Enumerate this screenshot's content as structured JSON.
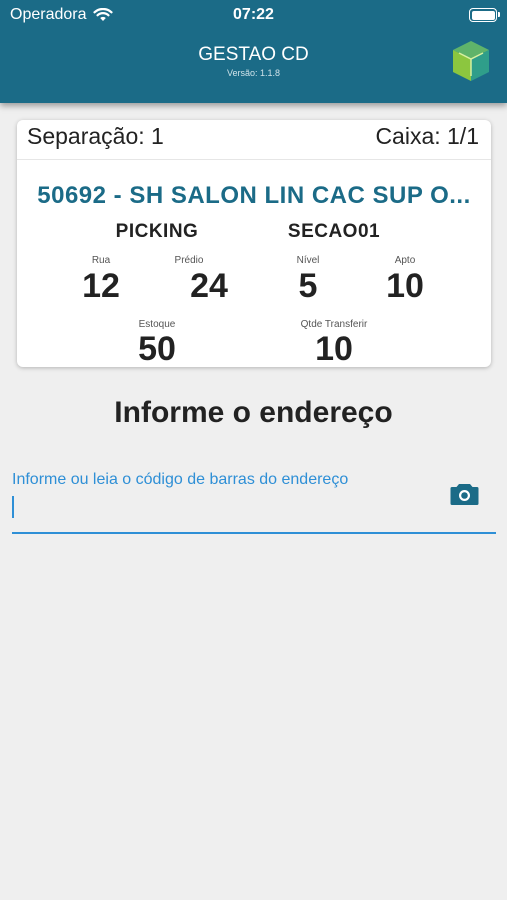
{
  "status_bar": {
    "carrier": "Operadora",
    "time": "07:22",
    "wifi_icon": "wifi-icon",
    "battery_icon": "battery-icon"
  },
  "header": {
    "title": "GESTAO CD",
    "version": "Versão:  1.1.8",
    "logo_icon": "cube-logo-icon"
  },
  "card": {
    "separacao": "Separação: 1",
    "caixa": "Caixa: 1/1",
    "product": "50692 - SH SALON LIN CAC SUP O...",
    "left_title": "PICKING",
    "right_title": "SECAO01",
    "rua_label": "Rua",
    "rua_value": "12",
    "predio_label": "Prédio",
    "predio_value": "24",
    "nivel_label": "Nível",
    "nivel_value": "5",
    "apto_label": "Apto",
    "apto_value": "10",
    "estoque_label": "Estoque",
    "estoque_value": "50",
    "qtde_label": "Qtde Transferir",
    "qtde_value": "10"
  },
  "main": {
    "heading": "Informe o endereço",
    "input_label": "Informe ou leia o código de barras do endereço",
    "input_value": "",
    "camera_icon": "camera-icon"
  },
  "colors": {
    "primary": "#1b6b87",
    "accent": "#2e8fd6",
    "background": "#efefef"
  }
}
